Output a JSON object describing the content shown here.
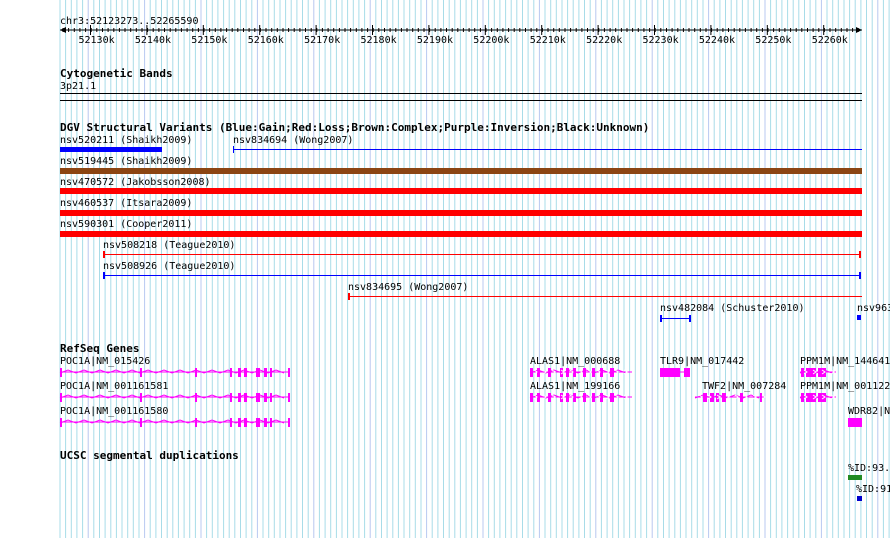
{
  "ruler": {
    "position": "chr3:52123273..52265590",
    "ticks": [
      "52130k",
      "52140k",
      "52150k",
      "52160k",
      "52170k",
      "52180k",
      "52190k",
      "52200k",
      "52210k",
      "52220k",
      "52230k",
      "52240k",
      "52250k",
      "52260k"
    ]
  },
  "tracks": {
    "cyto": {
      "title": "Cytogenetic Bands",
      "band": "3p21.1"
    },
    "dgv": {
      "title": "DGV Structural Variants (Blue:Gain;Red:Loss;Brown:Complex;Purple:Inversion;Black:Unknown)",
      "items": [
        {
          "label": "nsv520211 (Shaikh2009)"
        },
        {
          "label": "nsv834694 (Wong2007)"
        },
        {
          "label": "nsv519445 (Shaikh2009)"
        },
        {
          "label": "nsv470572 (Jakobsson2008)"
        },
        {
          "label": "nsv460537 (Itsara2009)"
        },
        {
          "label": "nsv590301 (Cooper2011)"
        },
        {
          "label": "nsv508218 (Teague2010)"
        },
        {
          "label": "nsv508926 (Teague2010)"
        },
        {
          "label": "nsv834695 (Wong2007)"
        },
        {
          "label": "nsv482084 (Schuster2010)"
        },
        {
          "label": "nsv963"
        }
      ]
    },
    "refseq": {
      "title": "RefSeq Genes",
      "items": [
        {
          "label": "POC1A|NM_015426"
        },
        {
          "label": "POC1A|NM_001161581"
        },
        {
          "label": "POC1A|NM_001161580"
        },
        {
          "label": "ALAS1|NM_000688"
        },
        {
          "label": "ALAS1|NM_199166"
        },
        {
          "label": "TLR9|NM_017442"
        },
        {
          "label": "TWF2|NM_007284"
        },
        {
          "label": "PPM1M|NM_144641"
        },
        {
          "label": "PPM1M|NM_001122"
        },
        {
          "label": "WDR82|NM"
        }
      ]
    },
    "segdup": {
      "title": "UCSC segmental duplications",
      "items": [
        {
          "label": "%ID:93."
        },
        {
          "label": "%ID:91"
        }
      ]
    }
  },
  "colors": {
    "gain": "#0000ff",
    "loss": "#ff0000",
    "complex": "#8b4513",
    "gene": "#ff00ff",
    "segdup_high": "#228b22",
    "segdup_low": "#0000cc",
    "grid": "#a8dce8"
  }
}
